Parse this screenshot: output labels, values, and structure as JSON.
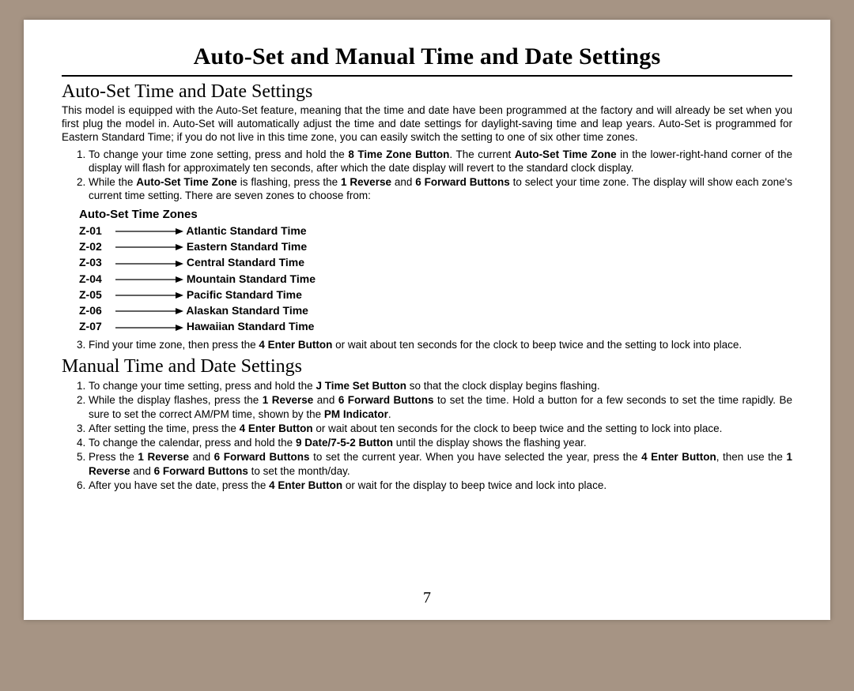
{
  "title": "Auto-Set and Manual Time and Date Settings",
  "section1": {
    "heading": "Auto-Set Time and Date Settings",
    "intro": "This model is equipped with the Auto-Set feature, meaning that the time and date have been programmed at the factory and will already be set when you first plug the model in.  Auto-Set will automatically adjust the time and date settings for daylight-saving time and leap years.  Auto-Set is programmed for Eastern Standard Time; if you do not live in this time zone, you can easily switch the setting to one of six other time zones.",
    "step1_a": "To change your time zone setting, press and hold the ",
    "step1_b": "8  Time Zone Button",
    "step1_c": ".  The current ",
    "step1_d": "Auto-Set Time Zone",
    "step1_e": " in the lower-right-hand corner of the display will flash for approximately ten seconds, after which the date display will revert to the standard clock display.",
    "step2_a": "While the ",
    "step2_b": "Auto-Set Time Zone",
    "step2_c": " is flashing, press the ",
    "step2_d": "1  Reverse",
    "step2_e": " and ",
    "step2_f": "6  Forward Buttons",
    "step2_g": " to select your time zone. The display will show each zone's current time setting.  There are seven zones to choose from:",
    "zones_heading": "Auto-Set Time Zones",
    "zones": [
      {
        "code": "Z-01",
        "name": "Atlantic Standard Time"
      },
      {
        "code": "Z-02",
        "name": "Eastern Standard Time"
      },
      {
        "code": "Z-03",
        "name": "Central Standard Time"
      },
      {
        "code": "Z-04",
        "name": "Mountain Standard Time"
      },
      {
        "code": "Z-05",
        "name": "Pacific Standard Time"
      },
      {
        "code": "Z-06",
        "name": "Alaskan Standard Time"
      },
      {
        "code": "Z-07",
        "name": "Hawaiian Standard Time"
      }
    ],
    "step3_a": "Find your time zone, then press the ",
    "step3_b": "4  Enter Button",
    "step3_c": " or wait about ten seconds for the clock to beep twice and the setting to lock into place."
  },
  "section2": {
    "heading": "Manual Time and Date Settings",
    "s1_a": "To change your time setting, press and hold the ",
    "s1_b": "J  Time Set Button",
    "s1_c": " so that the clock display begins flashing.",
    "s2_a": "While the display flashes, press the ",
    "s2_b": "1  Reverse",
    "s2_c": " and ",
    "s2_d": "6  Forward Buttons",
    "s2_e": " to set the time.  Hold a button for a few seconds to set the time rapidly.  Be sure to set the correct AM/PM time, shown by the ",
    "s2_f": "PM Indicator",
    "s2_g": ".",
    "s3_a": "After setting the time, press the ",
    "s3_b": "4  Enter Button",
    "s3_c": " or wait about ten seconds for the clock to beep twice and the setting to lock into place.",
    "s4_a": "To change the calendar, press and hold the ",
    "s4_b": "9  Date/7-5-2 Button",
    "s4_c": " until the display shows the flashing year.",
    "s5_a": "Press the ",
    "s5_b": "1  Reverse",
    "s5_c": " and ",
    "s5_d": "6  Forward Buttons",
    "s5_e": " to set the current year.  When you have selected the year, press the ",
    "s5_f": "4  Enter Button",
    "s5_g": ", then use the ",
    "s5_h": "1  Reverse",
    "s5_i": " and ",
    "s5_j": "6  Forward Buttons",
    "s5_k": " to set the month/day.",
    "s6_a": "After you have set the date, press the ",
    "s6_b": "4  Enter Button",
    "s6_c": " or wait for the display to beep twice and lock into place."
  },
  "page_number": "7"
}
